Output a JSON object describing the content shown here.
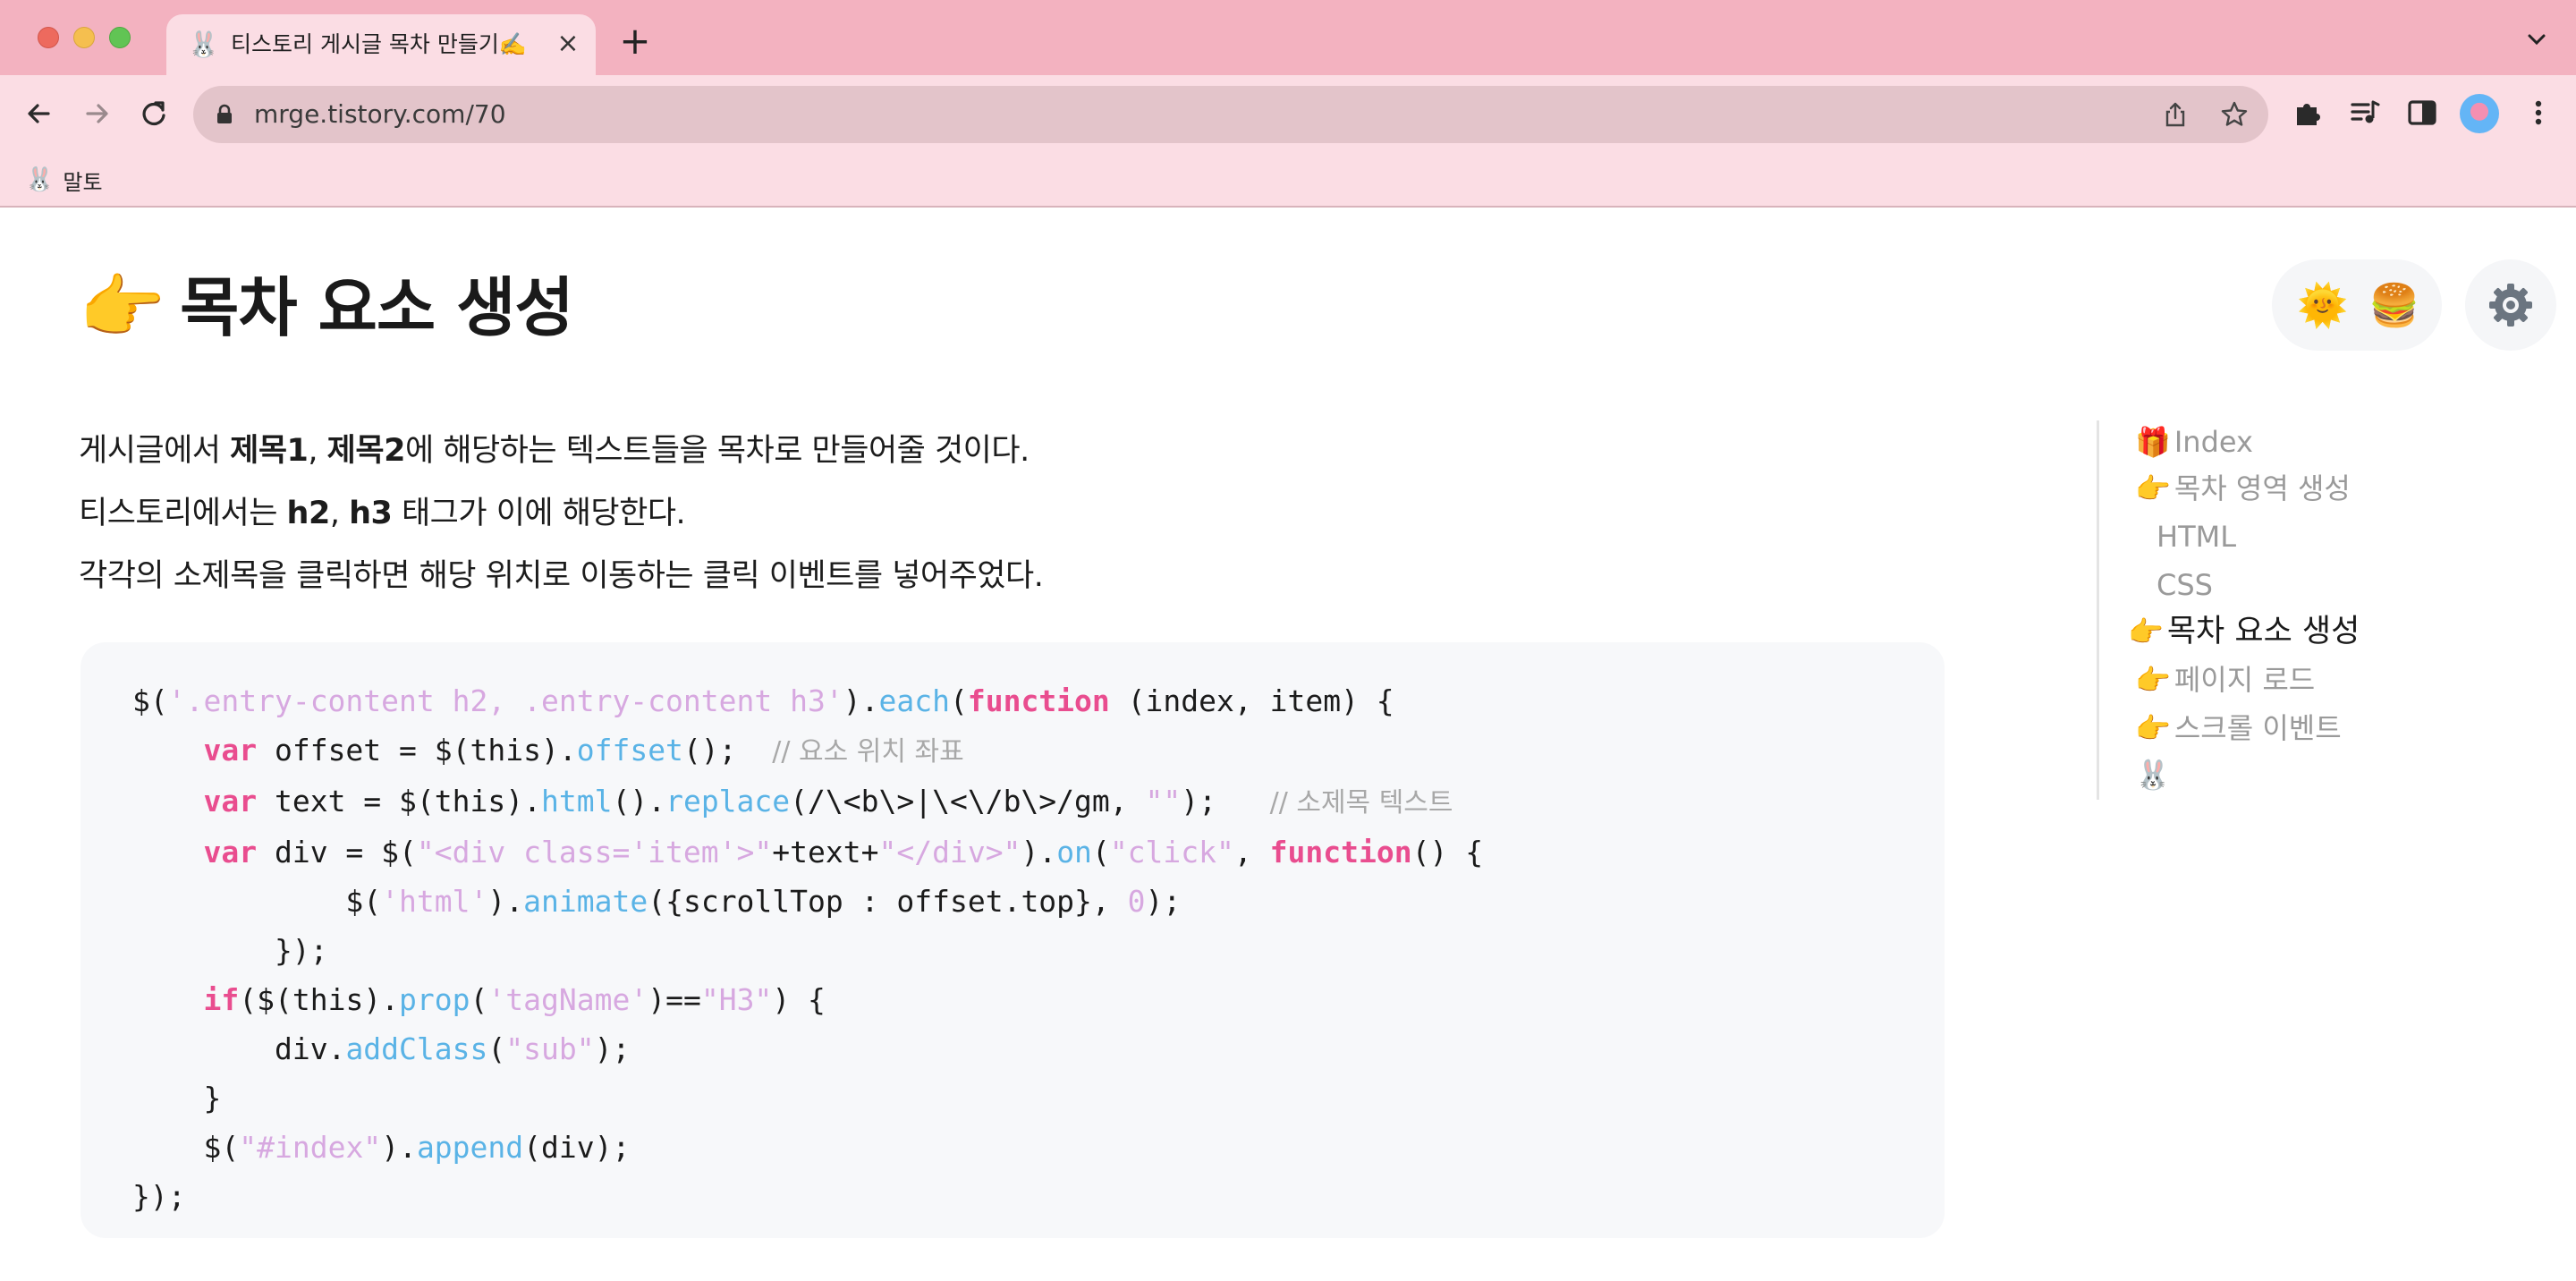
{
  "browser": {
    "tab": {
      "favicon_emoji": "🐰",
      "title": "티스토리 게시글 목차 만들기✍️",
      "close_glyph": "×"
    },
    "new_tab_glyph": "+",
    "address": {
      "url": "mrge.tistory.com/70"
    },
    "bookmarks": [
      {
        "emoji": "🐰",
        "label": "말토"
      }
    ],
    "icons": [
      "back-icon",
      "forward-icon",
      "reload-icon",
      "lock-icon",
      "share-icon",
      "star-icon",
      "extensions-icon",
      "media-icon",
      "side-panel-icon",
      "profile-avatar",
      "menu-icon"
    ]
  },
  "post": {
    "heading": {
      "emoji": "👉",
      "text": "목차 요소 생성"
    },
    "theme_toggle": {
      "light_emoji": "🌞",
      "dark_emoji": "🍔"
    },
    "paragraphs": [
      {
        "pre": "게시글에서 ",
        "b1": "제목1",
        "mid": ", ",
        "b2": "제목2",
        "post": "에 해당하는 텍스트들을 목차로 만들어줄 것이다."
      },
      {
        "pre": "티스토리에서는 ",
        "b1": "h2",
        "mid": ", ",
        "b2": "h3",
        "post": " 태그가 이에 해당한다."
      },
      {
        "text": "각각의 소제목을 클릭하면 해당 위치로 이동하는 클릭 이벤트를 넣어주었다."
      }
    ],
    "code": {
      "l1": {
        "a": "$(",
        "s1": "'.entry-content h2, .entry-content h3'",
        "b": ").",
        "f1": "each",
        "c": "(",
        "k1": "function",
        "d": " (index, item) {"
      },
      "l2": {
        "ind": "    ",
        "k1": "var",
        "a": " offset = $(this).",
        "f1": "offset",
        "b": "();  ",
        "cm": "// 요소 위치 좌표"
      },
      "l3": {
        "ind": "    ",
        "k1": "var",
        "a": " text = $(this).",
        "f1": "html",
        "b": "().",
        "f2": "replace",
        "c": "(/\\<b\\>|\\<\\/b\\>/gm, ",
        "s1": "\"\"",
        "d": ");   ",
        "cm": "// 소제목 텍스트"
      },
      "l4": {
        "ind": "    ",
        "k1": "var",
        "a": " div = $(",
        "s1": "\"<div class='item'>\"",
        "b": "+text+",
        "s2": "\"</div>\"",
        "c": ").",
        "f1": "on",
        "d": "(",
        "s3": "\"click\"",
        "e": ", ",
        "k2": "function",
        "g": "() {"
      },
      "l5": {
        "ind": "            ",
        "a": "$(",
        "s1": "'html'",
        "b": ").",
        "f1": "animate",
        "c": "({scrollTop : offset.top}, ",
        "n1": "0",
        "d": ");"
      },
      "l6": {
        "text": "        });"
      },
      "l7": {
        "ind": "    ",
        "k1": "if",
        "a": "($(this).",
        "f1": "prop",
        "b": "(",
        "s1": "'tagName'",
        "c": ")==",
        "s2": "\"H3\"",
        "d": ") {"
      },
      "l8": {
        "ind": "        ",
        "a": "div.",
        "f1": "addClass",
        "b": "(",
        "s1": "\"sub\"",
        "c": ");"
      },
      "l9": {
        "text": "    }"
      },
      "l10": {
        "ind": "    ",
        "a": "$(",
        "s1": "\"#index\"",
        "b": ").",
        "f1": "append",
        "c": "(div);"
      },
      "l11": {
        "text": "});"
      }
    }
  },
  "toc": {
    "items": [
      {
        "emoji": "🎁",
        "label": "Index"
      },
      {
        "emoji": "👉",
        "label": "목차 영역 생성"
      },
      {
        "label": "HTML"
      },
      {
        "label": "CSS"
      },
      {
        "emoji": "👉",
        "label": "목차 요소 생성"
      },
      {
        "emoji": "👉",
        "label": "페이지 로드"
      },
      {
        "emoji": "👉",
        "label": "스크롤 이벤트"
      },
      {
        "emoji": "🐰"
      }
    ]
  },
  "colors": {
    "tabbar": "#f3b2c0",
    "toolbar": "#fbdde4",
    "code_keyword": "#e94d8f",
    "code_function": "#5ab3e6",
    "code_string": "#d7a8e0"
  }
}
